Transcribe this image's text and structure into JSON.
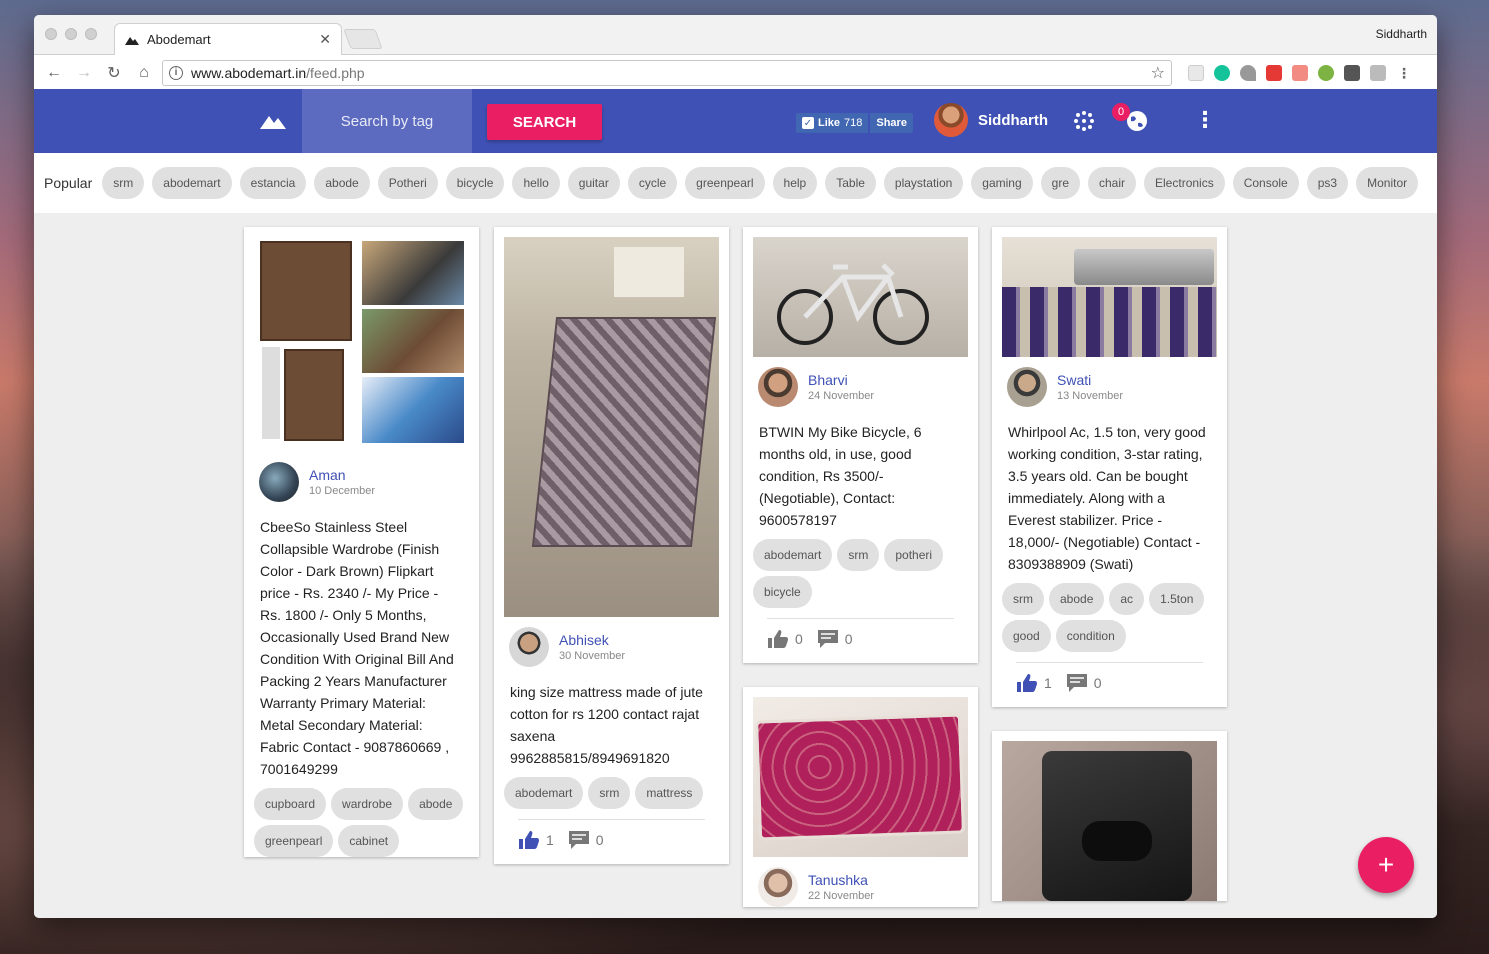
{
  "browser": {
    "tab_title": "Abodemart",
    "profile_name": "Siddharth",
    "url_host": "www.abodemart.in",
    "url_path": "/feed.php"
  },
  "header": {
    "search_placeholder": "Search by tag",
    "search_button": "SEARCH",
    "fb_like_label": "Like",
    "fb_like_count": "718",
    "fb_share_label": "Share",
    "user_name": "Siddharth",
    "notification_count": "0",
    "brand_color": "#3f51b5",
    "accent_color": "#e91e63"
  },
  "popular": {
    "label": "Popular",
    "tags": [
      "srm",
      "abodemart",
      "estancia",
      "abode",
      "Potheri",
      "bicycle",
      "hello",
      "guitar",
      "cycle",
      "greenpearl",
      "help",
      "Table",
      "playstation",
      "gaming",
      "gre",
      "chair",
      "Electronics",
      "Console",
      "ps3",
      "Monitor"
    ]
  },
  "posts": {
    "aman": {
      "author": "Aman",
      "date": "10 December",
      "text": "CbeeSo Stainless Steel Collapsible Wardrobe (Finish Color - Dark Brown) Flipkart price - Rs. 2340 /- My Price - Rs. 1800 /- Only 5 Months, Occasionally Used Brand New Condition With Original Bill And Packing 2 Years Manufacturer Warranty Primary Material: Metal Secondary Material: Fabric Contact - 9087860669 , 7001649299",
      "tags": [
        "cupboard",
        "wardrobe",
        "abode",
        "greenpearl",
        "cabinet"
      ]
    },
    "abhisek": {
      "author": "Abhisek",
      "date": "30 November",
      "text": "king size mattress made of jute cotton for rs 1200 contact rajat saxena 9962885815/8949691820",
      "tags": [
        "abodemart",
        "srm",
        "mattress"
      ],
      "likes": "1",
      "comments": "0"
    },
    "bharvi": {
      "author": "Bharvi",
      "date": "24 November",
      "text": "BTWIN My Bike Bicycle, 6 months old, in use, good condition, Rs 3500/- (Negotiable), Contact: 9600578197",
      "tags": [
        "abodemart",
        "srm",
        "potheri",
        "bicycle"
      ],
      "likes": "0",
      "comments": "0"
    },
    "tanushka": {
      "author": "Tanushka",
      "date": "22 November"
    },
    "swati": {
      "author": "Swati",
      "date": "13 November",
      "text": "Whirlpool Ac, 1.5 ton, very good working condition, 3-star rating, 3.5 years old. Can be bought immediately. Along with a Everest stabilizer. Price - 18,000/- (Negotiable) Contact - 8309388909 (Swati)",
      "tags": [
        "srm",
        "abode",
        "ac",
        "1.5ton",
        "good",
        "condition"
      ],
      "likes": "1",
      "comments": "0"
    }
  },
  "fab_label": "+"
}
